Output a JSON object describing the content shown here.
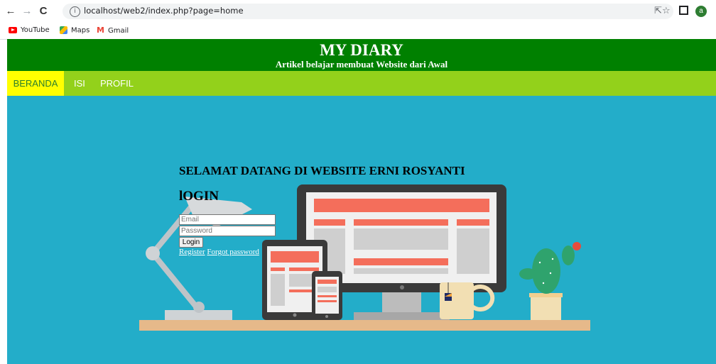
{
  "browser": {
    "url": "localhost/web2/index.php?page=home",
    "avatar_letter": "a",
    "bookmarks": [
      {
        "label": "YouTube",
        "icon": "youtube-icon"
      },
      {
        "label": "Maps",
        "icon": "maps-icon"
      },
      {
        "label": "Gmail",
        "icon": "gmail-icon"
      }
    ]
  },
  "header": {
    "title": "MY DIARY",
    "subtitle": "Artikel belajar membuat Website dari Awal"
  },
  "menu": [
    {
      "label": "BERANDA",
      "active": true
    },
    {
      "label": "ISI",
      "active": false
    },
    {
      "label": "PROFIL",
      "active": false
    }
  ],
  "main": {
    "welcome": "SELAMAT DATANG DI WEBSITE ERNI ROSYANTI",
    "login_heading": "lOGIN",
    "email_placeholder": "Email",
    "password_placeholder": "Password",
    "login_button": "Login",
    "register_link": "Register",
    "forgot_link": "Forgot password"
  },
  "colors": {
    "header": "#008000",
    "menu": "#93d11b",
    "menu_active": "#ffff00",
    "background": "#23adc9"
  }
}
